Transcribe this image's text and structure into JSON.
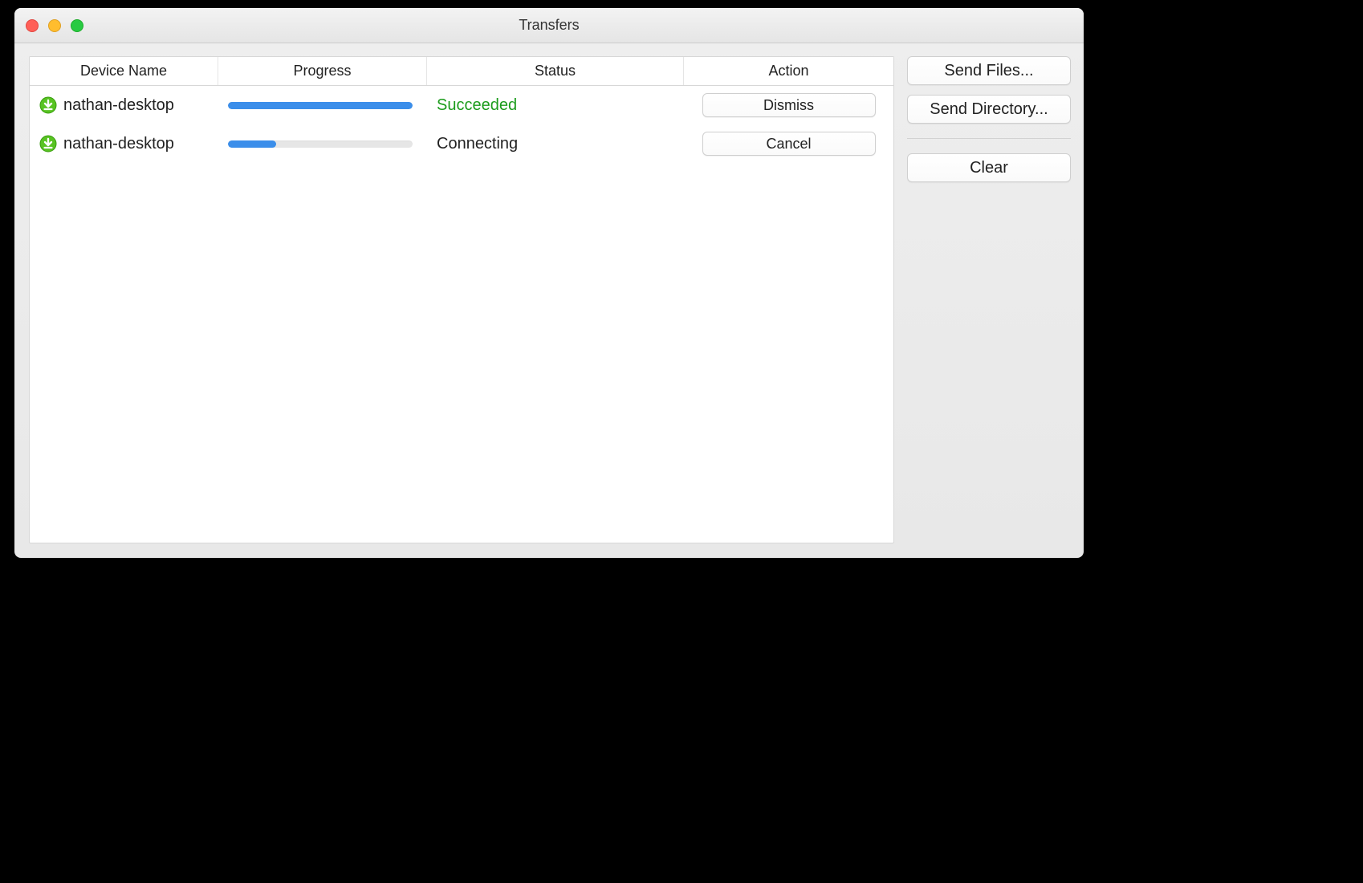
{
  "window": {
    "title": "Transfers"
  },
  "columns": {
    "device": "Device Name",
    "progress": "Progress",
    "status": "Status",
    "action": "Action"
  },
  "transfers": [
    {
      "icon": "download-icon",
      "device": "nathan-desktop",
      "progress_pct": 100,
      "status": "Succeeded",
      "status_kind": "succeeded",
      "action_label": "Dismiss"
    },
    {
      "icon": "download-icon",
      "device": "nathan-desktop",
      "progress_pct": 26,
      "status": "Connecting",
      "status_kind": "connecting",
      "action_label": "Cancel"
    }
  ],
  "sidebar": {
    "send_files": "Send Files...",
    "send_directory": "Send Directory...",
    "clear": "Clear"
  },
  "colors": {
    "progress_fill": "#3b8eea",
    "status_succeeded": "#1c9c1c"
  }
}
